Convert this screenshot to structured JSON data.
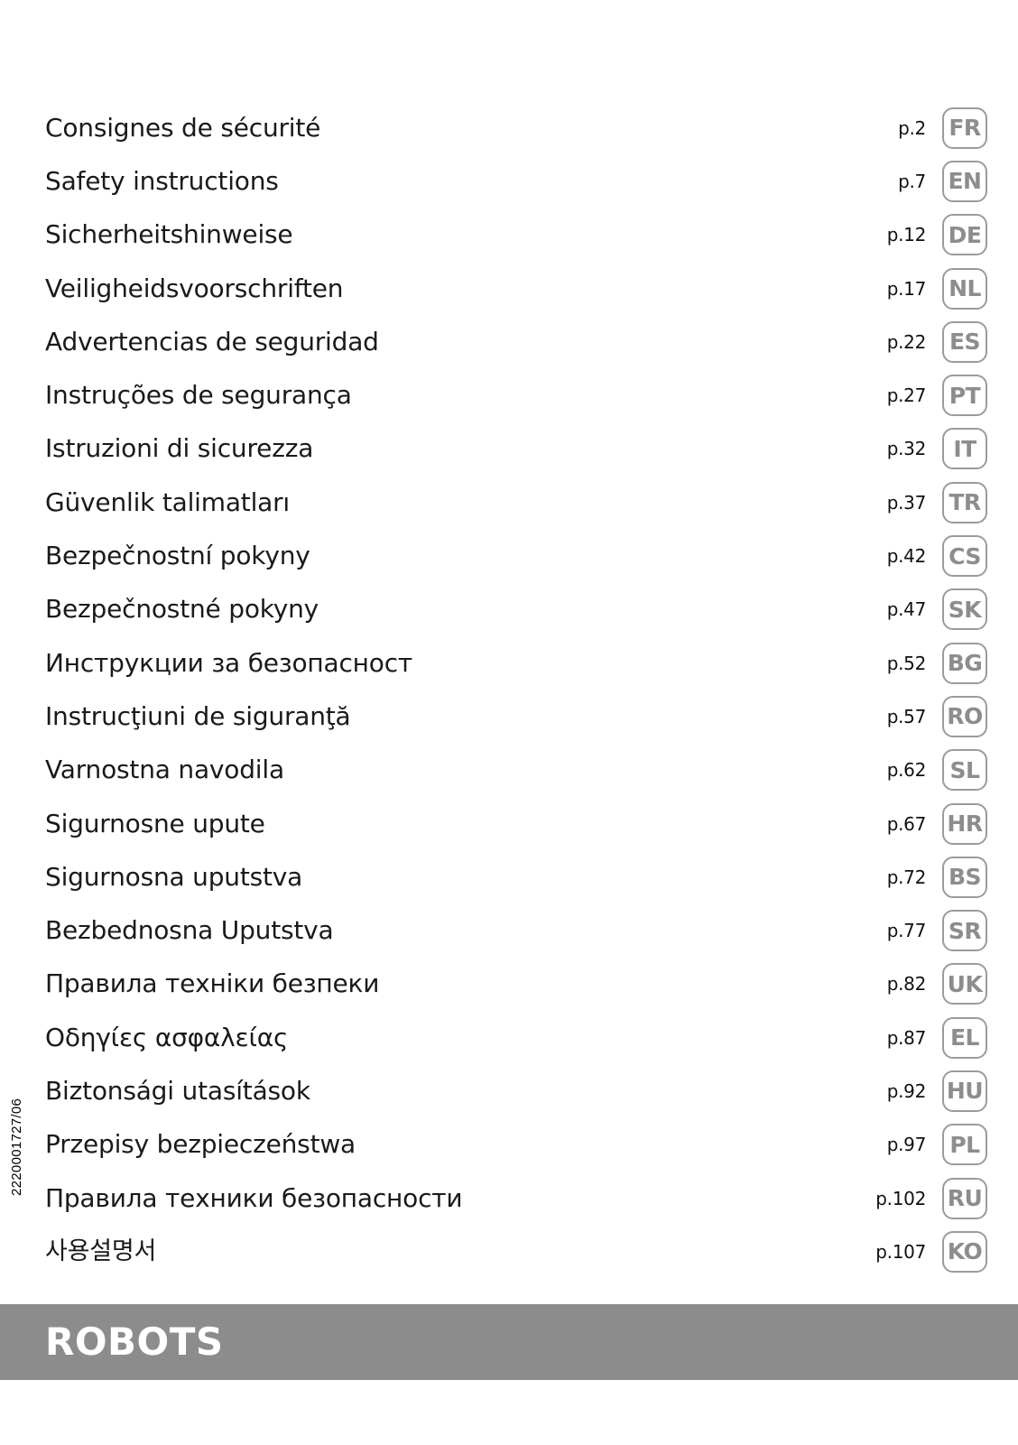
{
  "document": {
    "reference_code": "2220001727/06",
    "banner_label": "ROBOTS"
  },
  "toc": {
    "rows": [
      {
        "title": "Consignes de sécurité",
        "page": "p.2",
        "lang": "FR"
      },
      {
        "title": "Safety instructions",
        "page": "p.7",
        "lang": "EN"
      },
      {
        "title": "Sicherheitshinweise",
        "page": "p.12",
        "lang": "DE"
      },
      {
        "title": "Veiligheidsvoorschriften",
        "page": "p.17",
        "lang": "NL"
      },
      {
        "title": "Advertencias de seguridad",
        "page": "p.22",
        "lang": "ES"
      },
      {
        "title": "Instruções de segurança",
        "page": "p.27",
        "lang": "PT"
      },
      {
        "title": "Istruzioni di sicurezza",
        "page": "p.32",
        "lang": "IT"
      },
      {
        "title": "Güvenlik talimatları",
        "page": "p.37",
        "lang": "TR"
      },
      {
        "title": "Bezpečnostní pokyny",
        "page": "p.42",
        "lang": "CS"
      },
      {
        "title": "Bezpečnostné pokyny",
        "page": "p.47",
        "lang": "SK"
      },
      {
        "title": "Инструкции за безопасност",
        "page": "p.52",
        "lang": "BG"
      },
      {
        "title": "Instrucţiuni de siguranţă",
        "page": "p.57",
        "lang": "RO"
      },
      {
        "title": "Varnostna navodila",
        "page": "p.62",
        "lang": "SL"
      },
      {
        "title": "Sigurnosne upute",
        "page": "p.67",
        "lang": "HR"
      },
      {
        "title": "Sigurnosna uputstva",
        "page": "p.72",
        "lang": "BS"
      },
      {
        "title": "Bezbednosna Uputstva",
        "page": "p.77",
        "lang": "SR"
      },
      {
        "title": "Правила техніки безпеки",
        "page": "p.82",
        "lang": "UK"
      },
      {
        "title": "Οδηγίες ασφαλείας",
        "page": "p.87",
        "lang": "EL"
      },
      {
        "title": "Biztonsági utasítások",
        "page": "p.92",
        "lang": "HU"
      },
      {
        "title": "Przepisy bezpieczeństwa",
        "page": "p.97",
        "lang": "PL"
      },
      {
        "title": "Правила техники безопасности",
        "page": "p.102",
        "lang": "RU"
      },
      {
        "title": "사용설명서",
        "page": "p.107",
        "lang": "KO"
      }
    ]
  },
  "colors": {
    "banner_background": "#8c8c8c",
    "banner_text": "#ffffff",
    "badge_border": "#9b9b9b",
    "badge_text": "#8d8d8d",
    "title_text": "#1a1a1a"
  }
}
